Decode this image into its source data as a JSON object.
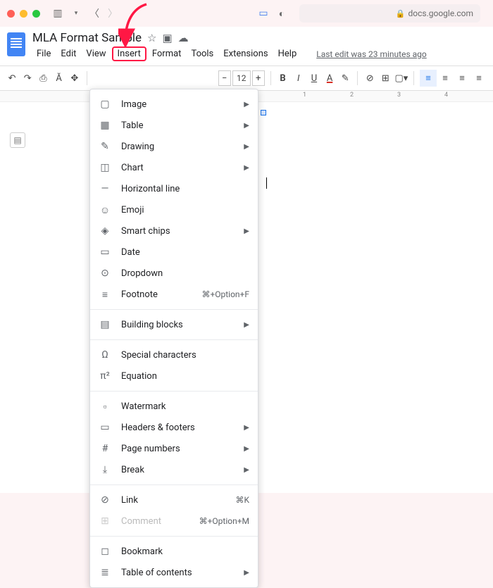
{
  "browser": {
    "url": "docs.google.com"
  },
  "doc": {
    "title": "MLA Format Sample",
    "menus": [
      "File",
      "Edit",
      "View",
      "Insert",
      "Format",
      "Tools",
      "Extensions",
      "Help"
    ],
    "highlighted_menu": "Insert",
    "last_edit": "Last edit was 23 minutes ago"
  },
  "toolbar": {
    "font_size": "12"
  },
  "ruler": {
    "marks": [
      "1",
      "2",
      "3",
      "4"
    ]
  },
  "insert_menu": {
    "groups": [
      [
        {
          "icon": "▢",
          "label": "Image",
          "sub": true
        },
        {
          "icon": "▦",
          "label": "Table",
          "sub": true
        },
        {
          "icon": "✎",
          "label": "Drawing",
          "sub": true
        },
        {
          "icon": "◫",
          "label": "Chart",
          "sub": true
        },
        {
          "icon": "—",
          "label": "Horizontal line"
        },
        {
          "icon": "☺",
          "label": "Emoji"
        },
        {
          "icon": "◈",
          "label": "Smart chips",
          "sub": true
        },
        {
          "icon": "▭",
          "label": "Date"
        },
        {
          "icon": "⊙",
          "label": "Dropdown"
        },
        {
          "icon": "≡",
          "label": "Footnote",
          "shortcut": "⌘+Option+F"
        }
      ],
      [
        {
          "icon": "▤",
          "label": "Building blocks",
          "sub": true
        }
      ],
      [
        {
          "icon": "Ω",
          "label": "Special characters"
        },
        {
          "icon": "π²",
          "label": "Equation"
        }
      ],
      [
        {
          "icon": "▫",
          "label": "Watermark"
        },
        {
          "icon": "▭",
          "label": "Headers & footers",
          "sub": true
        },
        {
          "icon": "#",
          "label": "Page numbers",
          "sub": true
        },
        {
          "icon": "⤓",
          "label": "Break",
          "sub": true
        }
      ],
      [
        {
          "icon": "⊘",
          "label": "Link",
          "shortcut": "⌘K"
        },
        {
          "icon": "⊞",
          "label": "Comment",
          "shortcut": "⌘+Option+M",
          "disabled": true
        }
      ],
      [
        {
          "icon": "◻",
          "label": "Bookmark"
        },
        {
          "icon": "≣",
          "label": "Table of contents",
          "sub": true
        }
      ]
    ]
  }
}
